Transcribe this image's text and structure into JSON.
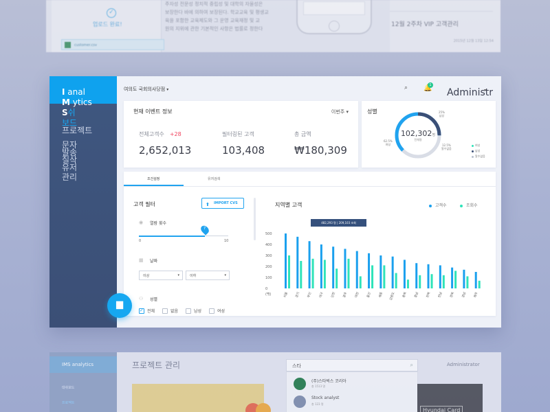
{
  "background": {
    "upload_done": "업로드 완료!",
    "upload_file": "customer.csv",
    "article_lines": [
      "주자성 전문성 정치적 중립성 및 대학의 자율성은",
      "보장한다 바에 의하여 보장된다. 학교교육 및 평생교",
      "육을 포함한 교육제도와 그 운영 교육재정 및 교",
      "원의 지위에 관한 기본적인 사항은 법률로 정한다"
    ],
    "recent_title": "12월 2주차 VIP 고객관리",
    "recent_date": "2015년 12월 13일 12:54",
    "bottom_brand": "IMS analytics",
    "bottom_nav": [
      "대쉬보드",
      "프로젝트"
    ],
    "bottom_title": "프로젝트 관리",
    "bottom_search": "스타",
    "bottom_results": [
      {
        "name": "(주)스타벅스 코리아",
        "sub": "총 1513 명"
      },
      {
        "name": "Stock analyst",
        "sub": "총 123 명"
      }
    ],
    "bottom_admin": "Administrator",
    "bottom_card": "Hyundai Card"
  },
  "sidebar": {
    "brand_lines": [
      {
        "bold": "I",
        "rest": "anal"
      },
      {
        "bold": "M",
        "rest": "ytics"
      },
      {
        "bold": "S",
        "rest": "쉬"
      }
    ],
    "nav_items": [
      "보드",
      "프로젝트",
      "문자",
      "발송",
      "질삭",
      "유저",
      "관리"
    ]
  },
  "topbar": {
    "location": "여의도 국회의사당점",
    "notification_count": "1",
    "user": "Administrator"
  },
  "event_card": {
    "title": "현재 이벤트 정보",
    "period": "이번주",
    "stats": [
      {
        "label": "전체고객수",
        "value": "2,652,013",
        "delta": "+28"
      },
      {
        "label": "필터링된 고객",
        "value": "103,408",
        "delta": ""
      },
      {
        "label": "총 금액",
        "value": "₩180,309",
        "delta": ""
      }
    ]
  },
  "gender_card": {
    "title": "성별",
    "total": "102,302",
    "total_unit": "명",
    "total_sub": "전체명",
    "segments": [
      {
        "label": "남성",
        "pct": "25%",
        "value": 25,
        "color": "#3b4f76"
      },
      {
        "label": "알수없음",
        "pct": "12.5%",
        "value": 12.5,
        "color": "#d9dde6"
      },
      {
        "label": "여성",
        "pct": "62.5%",
        "value": 62.5,
        "color": "#20a3ef"
      }
    ],
    "legend": [
      "여성",
      "남성",
      "알수없음"
    ]
  },
  "tabs": [
    "조건설정",
    "유저검색"
  ],
  "filter": {
    "title": "고객 필터",
    "import_label": "IMPORT CVS",
    "visits_label": "열람 횟수",
    "slider_value": "7",
    "slider_min": "0",
    "slider_max": "10",
    "date_label": "날짜",
    "date_from": "이상",
    "date_to": "이하",
    "gender_label": "성별",
    "gender_options": [
      "전체",
      "없음",
      "남성",
      "여성"
    ]
  },
  "region_chart": {
    "title": "지역별 고객",
    "legend": [
      "고객수",
      "조회수"
    ],
    "tooltip": "482,293 명  |  209,103 조회"
  },
  "chart_data": {
    "type": "bar",
    "title": "지역별 고객",
    "categories": [
      "서울",
      "경기",
      "부산",
      "대구",
      "인천",
      "광주",
      "대전",
      "울산",
      "세종",
      "강원도",
      "충북",
      "충남",
      "전북",
      "전남",
      "경북",
      "경남",
      "제주"
    ],
    "series": [
      {
        "name": "고객수",
        "color": "#1aa0ee",
        "values": [
          500,
          470,
          430,
          400,
          380,
          360,
          340,
          320,
          300,
          290,
          260,
          230,
          220,
          210,
          190,
          170,
          150
        ]
      },
      {
        "name": "조회수",
        "color": "#2ee3b9",
        "values": [
          300,
          250,
          270,
          260,
          180,
          270,
          110,
          210,
          210,
          140,
          80,
          120,
          130,
          120,
          160,
          110,
          70
        ]
      }
    ],
    "yticks": [
      "500",
      "400",
      "300",
      "200",
      "100",
      "0"
    ],
    "ylim": [
      0,
      500
    ],
    "ylabel": "(백)"
  }
}
